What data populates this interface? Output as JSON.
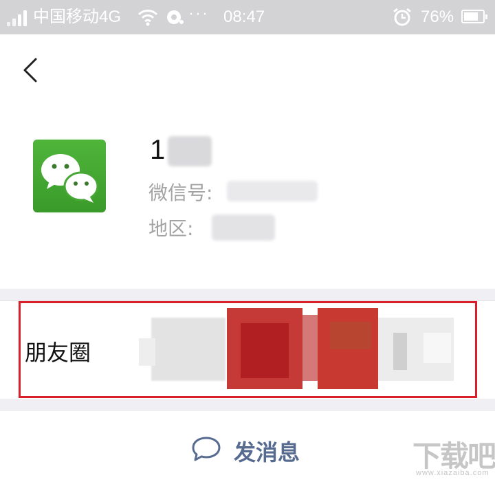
{
  "status_bar": {
    "carrier": "中国移动4G",
    "more": "···",
    "time": "08:47",
    "battery": "76%",
    "battery_level": 0.76
  },
  "profile": {
    "name_visible": "1",
    "wechat_id_label": "微信号:",
    "region_label": "地区:"
  },
  "moments": {
    "label": "朋友圈"
  },
  "actions": {
    "send_message": "发消息"
  },
  "watermark": {
    "text": "下载吧",
    "url_text": "www.xiazaiba.com"
  },
  "colors": {
    "status_bar_bg": "#d3d3d5",
    "highlight_border": "#d8202b",
    "link_blue": "#566b8f",
    "wechat_green": "#4fb53a"
  }
}
